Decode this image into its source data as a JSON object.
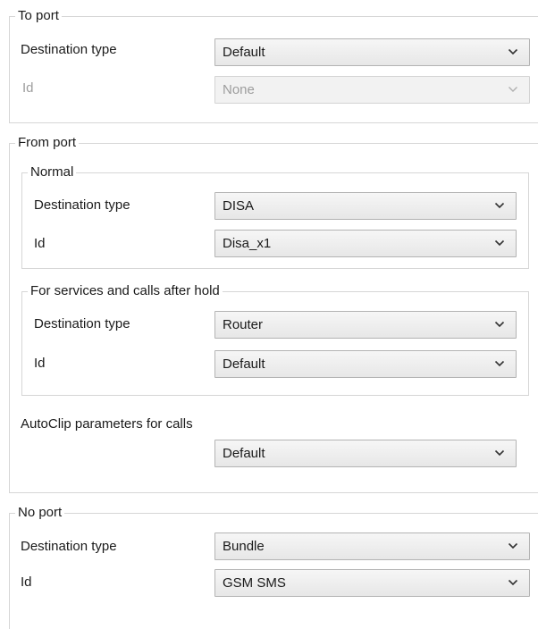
{
  "to_port": {
    "title": "To port",
    "destination_type_label": "Destination type",
    "destination_type_value": "Default",
    "id_label": "Id",
    "id_value": "None"
  },
  "from_port": {
    "title": "From port",
    "normal": {
      "title": "Normal",
      "destination_type_label": "Destination type",
      "destination_type_value": "DISA",
      "id_label": "Id",
      "id_value": "Disa_x1"
    },
    "services": {
      "title": "For services and calls after hold",
      "destination_type_label": "Destination type",
      "destination_type_value": "Router",
      "id_label": "Id",
      "id_value": "Default"
    },
    "autoclip_label": "AutoClip parameters for calls",
    "autoclip_value": "Default"
  },
  "no_port": {
    "title": "No port",
    "destination_type_label": "Destination type",
    "destination_type_value": "Bundle",
    "id_label": "Id",
    "id_value": "GSM SMS"
  },
  "icons": {
    "dropdown": "chevron-down-icon"
  },
  "colors": {
    "border": "#d6d6d6",
    "combo_border": "#b3b3b3",
    "disabled_text": "#9d9d9d"
  }
}
